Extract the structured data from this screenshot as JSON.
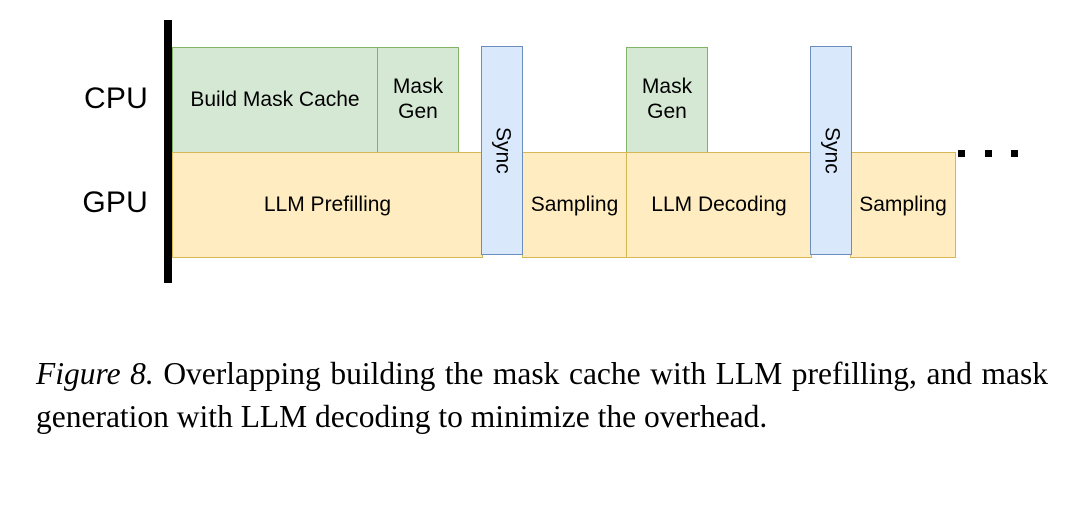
{
  "figure": {
    "label": "Figure 8.",
    "caption": "Overlapping building the mask cache with LLM prefilling, and mask generation with LLM decoding to minimize the overhead.",
    "ellipsis": "..."
  },
  "diagram": {
    "lanes": [
      {
        "name": "cpu",
        "label": "CPU"
      },
      {
        "name": "gpu",
        "label": "GPU"
      }
    ],
    "cpu_blocks": [
      {
        "label": "Build Mask Cache"
      },
      {
        "label": "Mask Gen"
      },
      {
        "label": "Mask Gen"
      }
    ],
    "gpu_blocks": [
      {
        "label": "LLM Prefilling"
      },
      {
        "label": "Sampling"
      },
      {
        "label": "LLM Decoding"
      },
      {
        "label": "Sampling"
      }
    ],
    "sync_blocks": [
      {
        "label": "Sync"
      },
      {
        "label": "Sync"
      }
    ]
  },
  "colors": {
    "green_fill": "#d5e8d4",
    "green_border": "#82b366",
    "yellow_fill": "#ffecc0",
    "yellow_border": "#d6b656",
    "blue_fill": "#dae8fc",
    "blue_border": "#6c8ebf",
    "axis": "#000000",
    "background": "#ffffff"
  }
}
